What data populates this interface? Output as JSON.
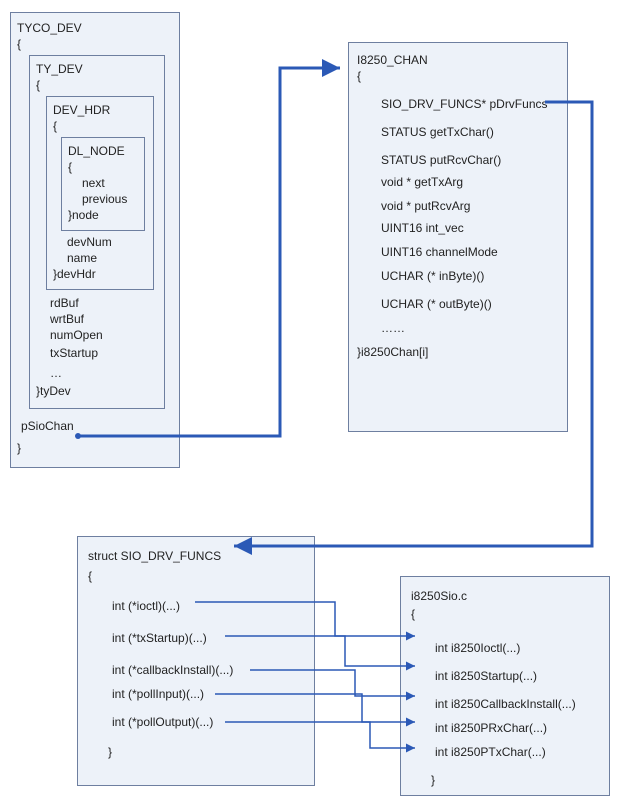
{
  "tyco": {
    "title": "TYCO_DEV",
    "open": "{",
    "ty_dev": {
      "title": "TY_DEV",
      "open": "{",
      "dev_hdr": {
        "title": "DEV_HDR",
        "open": "{",
        "dl_node": {
          "title": "DL_NODE",
          "open": "{",
          "f1": "next",
          "f2": "previous",
          "close": "}node"
        },
        "f1": "devNum",
        "f2": "name",
        "close": "}devHdr"
      },
      "f1": "rdBuf",
      "f2": "wrtBuf",
      "f3": "numOpen",
      "f4": "txStartup",
      "f5": "…",
      "close": "}tyDev"
    },
    "pSioChan": "pSioChan",
    "close": "}"
  },
  "i8250chan": {
    "title": "I8250_CHAN",
    "open": "{",
    "f1": "SIO_DRV_FUNCS* pDrvFuncs",
    "f2": "STATUS getTxChar()",
    "f3": "STATUS putRcvChar()",
    "f4": "void * getTxArg",
    "f5": "void * putRcvArg",
    "f6": "UINT16 int_vec",
    "f7": "UINT16 channelMode",
    "f8": "UCHAR (* inByte)()",
    "f9": "UCHAR (* outByte)()",
    "f10": "……",
    "close": "}i8250Chan[i]"
  },
  "siofuncs": {
    "title": "struct SIO_DRV_FUNCS",
    "open": "{",
    "f1": "int (*ioctl)(...)",
    "f2": "int (*txStartup)(...)",
    "f3": "int (*callbackInstall)(...)",
    "f4": "int (*pollInput)(...)",
    "f5": "int (*pollOutput)(...)",
    "close": "}"
  },
  "i8250sio": {
    "title": "i8250Sio.c",
    "open": "{",
    "f1": "int i8250Ioctl(...)",
    "f2": "int i8250Startup(...)",
    "f3": "int i8250CallbackInstall(...)",
    "f4": "int i8250PRxChar(...)",
    "f5": "int i8250PTxChar(...)",
    "close": "}"
  }
}
